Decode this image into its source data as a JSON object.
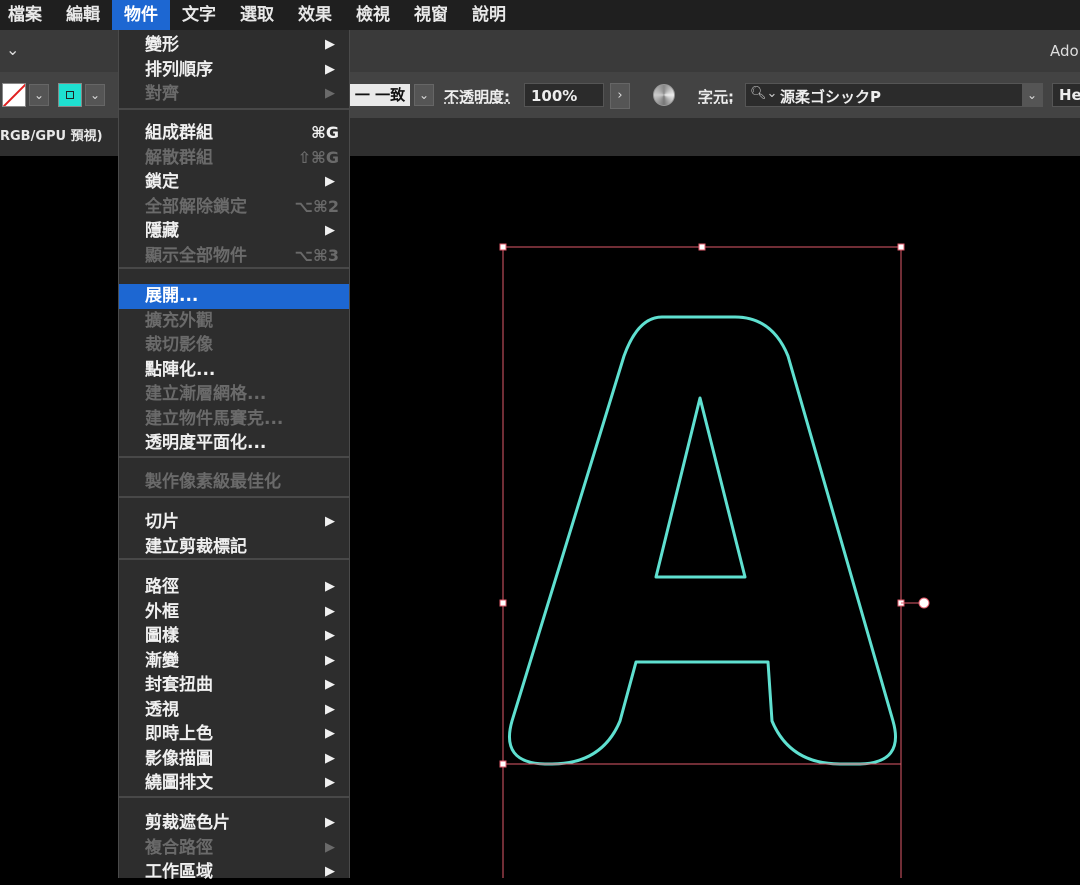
{
  "menubar": {
    "items": [
      {
        "label": "檔案"
      },
      {
        "label": "編輯"
      },
      {
        "label": "物件"
      },
      {
        "label": "文字"
      },
      {
        "label": "選取"
      },
      {
        "label": "效果"
      },
      {
        "label": "檢視"
      },
      {
        "label": "視窗"
      },
      {
        "label": "說明"
      }
    ],
    "active_index": 2
  },
  "toolbar": {
    "app_title": "Ado",
    "stroke_profile": "一 一致",
    "opacity_label": "不透明度:",
    "opacity_value": "100%",
    "char_label": "字元:",
    "font_name": "源柔ゴシックP",
    "font_style": "He",
    "fill_color": "#1ee0d0",
    "stroke_color": "none"
  },
  "document": {
    "tab_label": "RGB/GPU 預視)"
  },
  "object_menu": {
    "items": [
      {
        "label": "變形",
        "shortcut": "",
        "submenu": true,
        "enabled": true
      },
      {
        "label": "排列順序",
        "shortcut": "",
        "submenu": true,
        "enabled": true
      },
      {
        "label": "對齊",
        "shortcut": "",
        "submenu": true,
        "enabled": false
      },
      {
        "label": "組成群組",
        "shortcut": "⌘G",
        "submenu": false,
        "enabled": true
      },
      {
        "label": "解散群組",
        "shortcut": "⇧⌘G",
        "submenu": false,
        "enabled": false
      },
      {
        "label": "鎖定",
        "shortcut": "",
        "submenu": true,
        "enabled": true
      },
      {
        "label": "全部解除鎖定",
        "shortcut": "⌥⌘2",
        "submenu": false,
        "enabled": false
      },
      {
        "label": "隱藏",
        "shortcut": "",
        "submenu": true,
        "enabled": true
      },
      {
        "label": "顯示全部物件",
        "shortcut": "⌥⌘3",
        "submenu": false,
        "enabled": false
      },
      {
        "label": "展開...",
        "shortcut": "",
        "submenu": false,
        "enabled": true,
        "highlighted": true
      },
      {
        "label": "擴充外觀",
        "shortcut": "",
        "submenu": false,
        "enabled": false
      },
      {
        "label": "裁切影像",
        "shortcut": "",
        "submenu": false,
        "enabled": false
      },
      {
        "label": "點陣化...",
        "shortcut": "",
        "submenu": false,
        "enabled": true
      },
      {
        "label": "建立漸層網格...",
        "shortcut": "",
        "submenu": false,
        "enabled": false
      },
      {
        "label": "建立物件馬賽克...",
        "shortcut": "",
        "submenu": false,
        "enabled": false
      },
      {
        "label": "透明度平面化...",
        "shortcut": "",
        "submenu": false,
        "enabled": true
      },
      {
        "label": "製作像素級最佳化",
        "shortcut": "",
        "submenu": false,
        "enabled": false
      },
      {
        "label": "切片",
        "shortcut": "",
        "submenu": true,
        "enabled": true
      },
      {
        "label": "建立剪裁標記",
        "shortcut": "",
        "submenu": false,
        "enabled": true
      },
      {
        "label": "路徑",
        "shortcut": "",
        "submenu": true,
        "enabled": true
      },
      {
        "label": "外框",
        "shortcut": "",
        "submenu": true,
        "enabled": true
      },
      {
        "label": "圖樣",
        "shortcut": "",
        "submenu": true,
        "enabled": true
      },
      {
        "label": "漸變",
        "shortcut": "",
        "submenu": true,
        "enabled": true
      },
      {
        "label": "封套扭曲",
        "shortcut": "",
        "submenu": true,
        "enabled": true
      },
      {
        "label": "透視",
        "shortcut": "",
        "submenu": true,
        "enabled": true
      },
      {
        "label": "即時上色",
        "shortcut": "",
        "submenu": true,
        "enabled": true
      },
      {
        "label": "影像描圖",
        "shortcut": "",
        "submenu": true,
        "enabled": true
      },
      {
        "label": "繞圖排文",
        "shortcut": "",
        "submenu": true,
        "enabled": true
      },
      {
        "label": "剪裁遮色片",
        "shortcut": "",
        "submenu": true,
        "enabled": true
      },
      {
        "label": "複合路徑",
        "shortcut": "",
        "submenu": true,
        "enabled": false
      },
      {
        "label": "工作區域",
        "shortcut": "",
        "submenu": true,
        "enabled": true
      }
    ]
  },
  "artwork": {
    "outline_color": "#5fe0d0",
    "selection_color": "#e05a6a"
  }
}
